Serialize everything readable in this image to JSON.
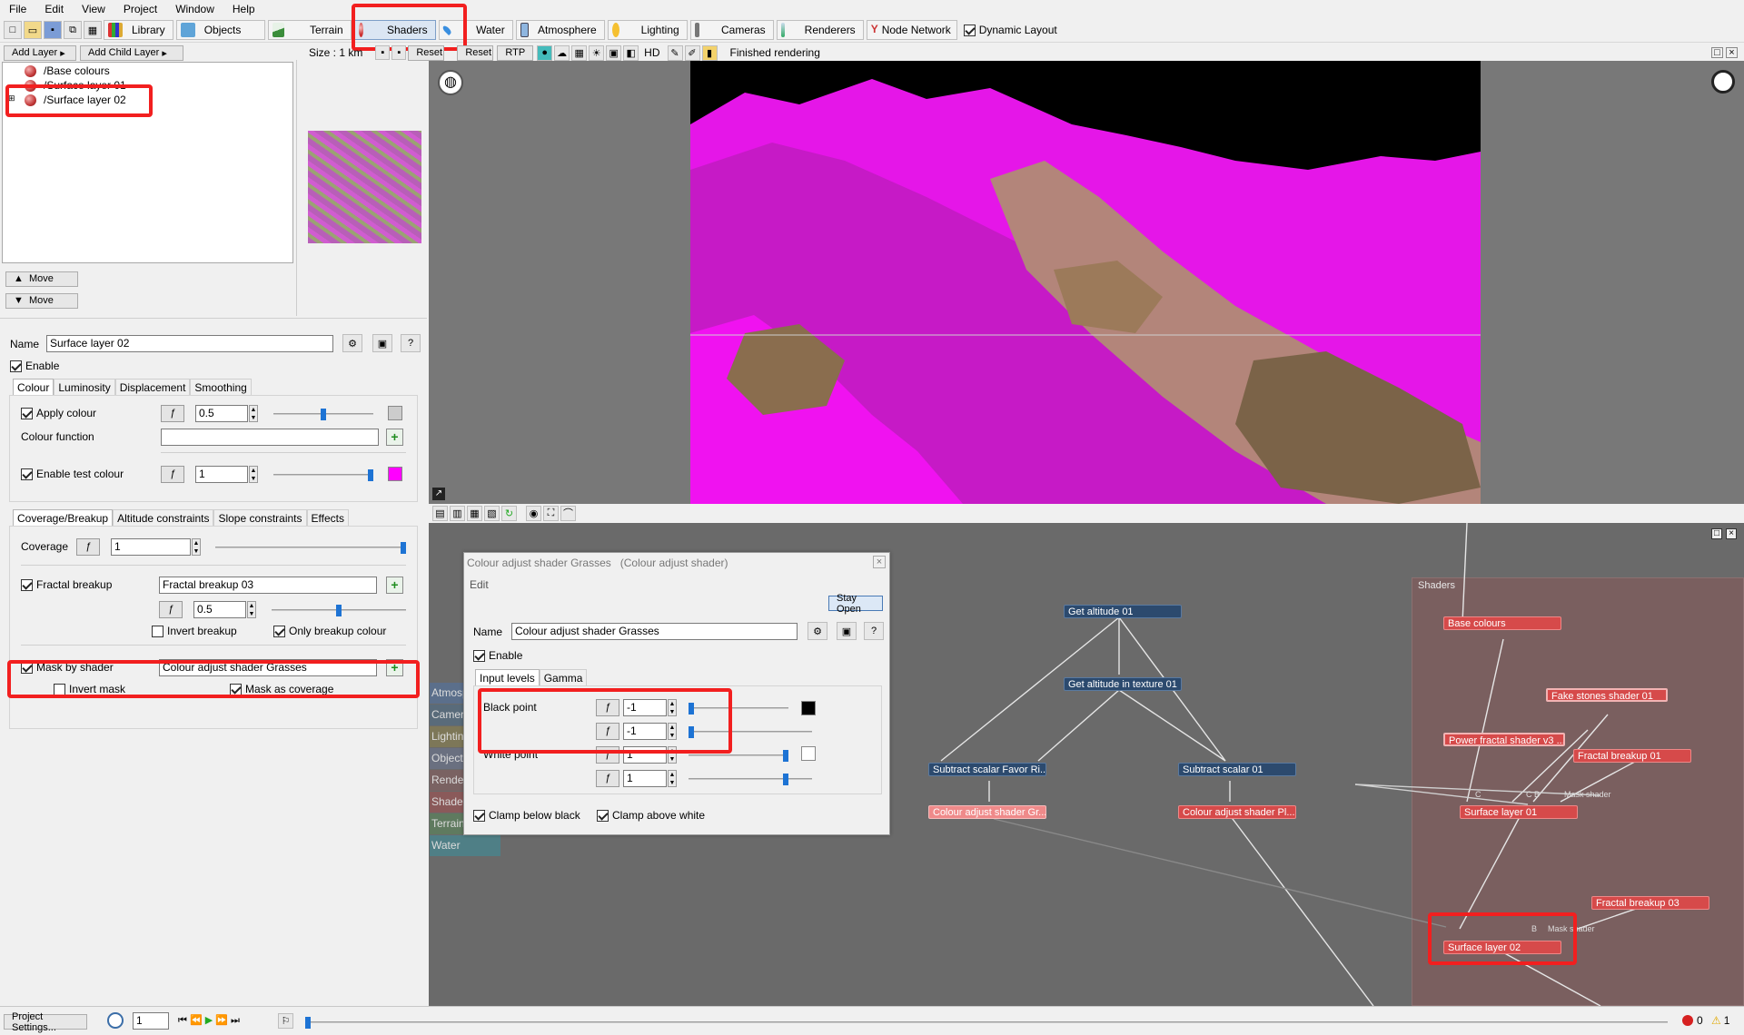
{
  "menu": [
    "File",
    "Edit",
    "View",
    "Project",
    "Window",
    "Help"
  ],
  "toolbar": {
    "library": "Library",
    "objects": "Objects",
    "terrain": "Terrain",
    "shaders": "Shaders",
    "water": "Water",
    "atmosphere": "Atmosphere",
    "lighting": "Lighting",
    "cameras": "Cameras",
    "renderers": "Renderers",
    "node_network": "Node Network",
    "dynamic_layout": "Dynamic Layout"
  },
  "layers": {
    "add_layer": "Add Layer",
    "add_child_layer": "Add Child Layer",
    "items": [
      "/Base colours",
      "/Surface layer 01",
      "/Surface layer 02"
    ],
    "move_up": "Move",
    "move_down": "Move"
  },
  "preview_bar": {
    "size": "Size : 1 km",
    "reset1": "Reset",
    "reset2": "Reset",
    "rtp": "RTP",
    "hd": "HD",
    "status": "Finished rendering"
  },
  "props": {
    "name_label": "Name",
    "name_value": "Surface layer 02",
    "enable": "Enable",
    "tabs": [
      "Colour",
      "Luminosity",
      "Displacement",
      "Smoothing"
    ],
    "apply_colour": "Apply colour",
    "apply_colour_value": "0.5",
    "apply_colour_fraction": 0.5,
    "colour_function": "Colour function",
    "enable_test_colour": "Enable test colour",
    "test_colour_value": "1",
    "test_colour_fraction": 1.0,
    "test_colour_color": "#ff00ff",
    "tabs2": [
      "Coverage/Breakup",
      "Altitude constraints",
      "Slope constraints",
      "Effects"
    ],
    "coverage": "Coverage",
    "coverage_value": "1",
    "coverage_fraction": 1.0,
    "fractal_breakup": "Fractal breakup",
    "fractal_breakup_value": "Fractal breakup 03",
    "breakup_value": "0.5",
    "breakup_fraction": 0.5,
    "invert_breakup": "Invert breakup",
    "only_breakup_colour": "Only breakup colour",
    "mask_by_shader": "Mask by shader",
    "mask_by_shader_value": "Colour adjust shader Grasses",
    "invert_mask": "Invert mask",
    "mask_as_coverage": "Mask as coverage"
  },
  "dialog": {
    "title": "Colour adjust shader Grasses",
    "subtitle": "(Colour adjust shader)",
    "edit": "Edit",
    "stay_open": "Stay Open",
    "name_label": "Name",
    "name_value": "Colour adjust shader Grasses",
    "enable": "Enable",
    "tabs": [
      "Input levels",
      "Gamma"
    ],
    "black_point": "Black point",
    "black_values": [
      "-1",
      "-1"
    ],
    "white_point": "White point",
    "white_values": [
      "1",
      "1"
    ],
    "clamp_below": "Clamp below black",
    "clamp_above": "Clamp above white"
  },
  "side_tabs": [
    "Atmosphere",
    "Cameras",
    "Lighting",
    "Objects",
    "Renderers",
    "Shaders",
    "Terrain",
    "Water"
  ],
  "network": {
    "group_label": "Shaders",
    "nodes": {
      "get_altitude": "Get altitude 01",
      "get_altitude_tex": "Get altitude in texture 01",
      "subtract_favor": "Subtract scalar Favor Ri...",
      "subtract_01": "Subtract scalar 01",
      "cas_grasses": "Colour adjust shader Gr...",
      "cas_pl": "Colour adjust shader Pl...",
      "base_colours": "Base colours",
      "fake_stones": "Fake stones shader 01",
      "power_fractal": "Power fractal shader v3 ...",
      "fractal_breakup_01": "Fractal breakup 01",
      "surface_layer_01": "Surface layer 01",
      "fractal_breakup_03": "Fractal breakup 03",
      "surface_layer_02": "Surface layer 02"
    },
    "port_labels": {
      "c": "C",
      "cb": "C  B",
      "mask": "Mask shader",
      "b": "B",
      "mask2": "Mask shader"
    }
  },
  "statusbar": {
    "project_settings": "Project Settings...",
    "frame": "1",
    "errors": "0",
    "warnings": "1"
  },
  "colors": {
    "shader_red": "#d64a4a",
    "node_blue": "#2c4a6e",
    "highlight": "#f21f1f",
    "magenta": "#ff00ff"
  }
}
